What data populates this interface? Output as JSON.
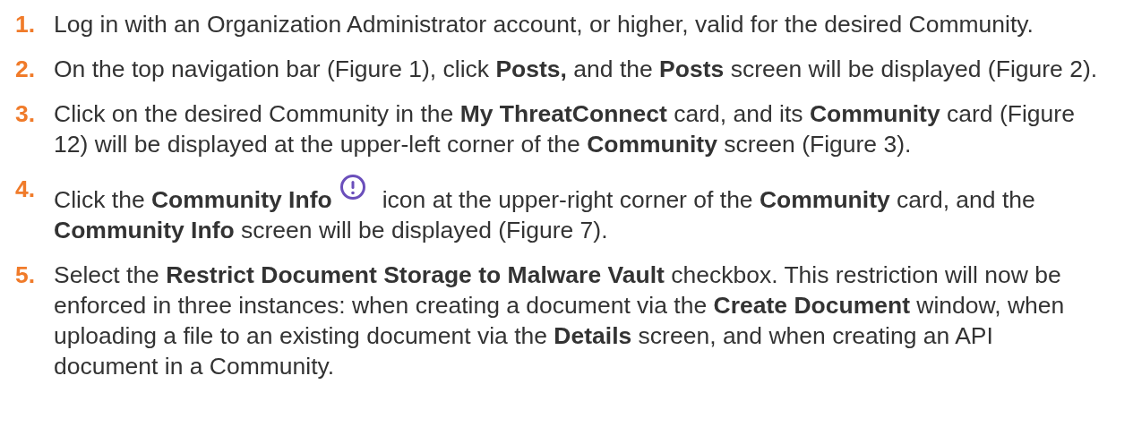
{
  "steps": [
    {
      "number": "1.",
      "parts": [
        {
          "kind": "text",
          "text": "Log in with an Organization Administrator account, or higher, valid for the desired Community."
        }
      ]
    },
    {
      "number": "2.",
      "parts": [
        {
          "kind": "text",
          "text": "On the top navigation bar (Figure 1), click **Posts,** and the **Posts** screen will be displayed (Figure 2)."
        }
      ]
    },
    {
      "number": "3.",
      "parts": [
        {
          "kind": "text",
          "text": "Click on the desired Community in the **My ThreatConnect** card, and its **Community** card (Figure 12) will be displayed at the upper-left corner of the **Community** screen (Figure 3)."
        }
      ]
    },
    {
      "number": "4.",
      "parts": [
        {
          "kind": "text",
          "text": "Click the **Community Info**"
        },
        {
          "kind": "icon"
        },
        {
          "kind": "text",
          "text": "icon at the upper-right corner of the **Community** card, and the"
        },
        {
          "kind": "line",
          "text": "**Community Info** screen will be displayed (Figure 7)."
        }
      ]
    },
    {
      "number": "5.",
      "parts": [
        {
          "kind": "text",
          "text": "Select the **Restrict Document Storage to Malware Vault** checkbox. This restriction will now be enforced in three instances: when creating a document via the **Create Document** window, when uploading a file to an existing document via the **Details** screen, and when creating an API document in a Community."
        }
      ]
    }
  ]
}
